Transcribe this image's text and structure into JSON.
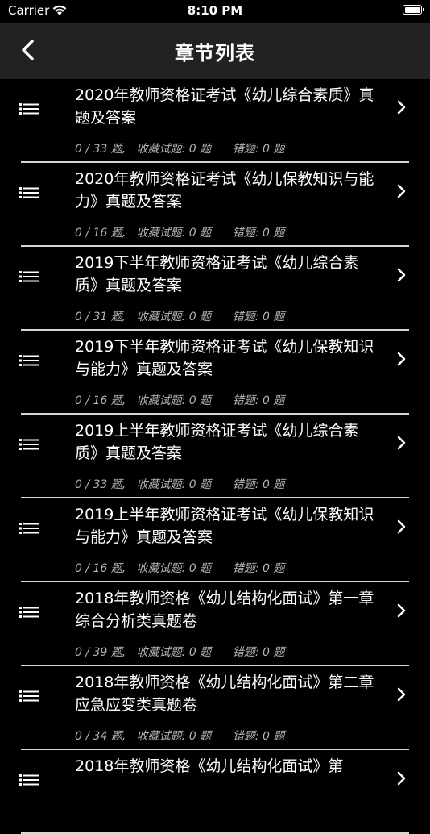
{
  "status_bar": {
    "carrier": "Carrier",
    "time": "8:10 PM"
  },
  "nav": {
    "title": "章节列表"
  },
  "chapters": [
    {
      "title": "2020年教师资格证考试《幼儿综合素质》真题及答案",
      "meta": "0 / 33 题,   收藏试题: 0 题      错题: 0 题"
    },
    {
      "title": "2020年教师资格证考试《幼儿保教知识与能力》真题及答案",
      "meta": "0 / 16 题,   收藏试题: 0 题      错题: 0 题"
    },
    {
      "title": "2019下半年教师资格证考试《幼儿综合素质》真题及答案",
      "meta": "0 / 31 题,   收藏试题: 0 题      错题: 0 题"
    },
    {
      "title": "2019下半年教师资格证考试《幼儿保教知识与能力》真题及答案",
      "meta": "0 / 16 题,   收藏试题: 0 题      错题: 0 题"
    },
    {
      "title": "2019上半年教师资格证考试《幼儿综合素质》真题及答案",
      "meta": "0 / 33 题,   收藏试题: 0 题      错题: 0 题"
    },
    {
      "title": "2019上半年教师资格证考试《幼儿保教知识与能力》真题及答案",
      "meta": "0 / 16 题,   收藏试题: 0 题      错题: 0 题"
    },
    {
      "title": "2018年教师资格《幼儿结构化面试》第一章综合分析类真题卷",
      "meta": "0 / 39 题,   收藏试题: 0 题      错题: 0 题"
    },
    {
      "title": "2018年教师资格《幼儿结构化面试》第二章应急应变类真题卷",
      "meta": "0 / 34 题,   收藏试题: 0 题      错题: 0 题"
    },
    {
      "title": "2018年教师资格《幼儿结构化面试》第",
      "meta": ""
    }
  ]
}
